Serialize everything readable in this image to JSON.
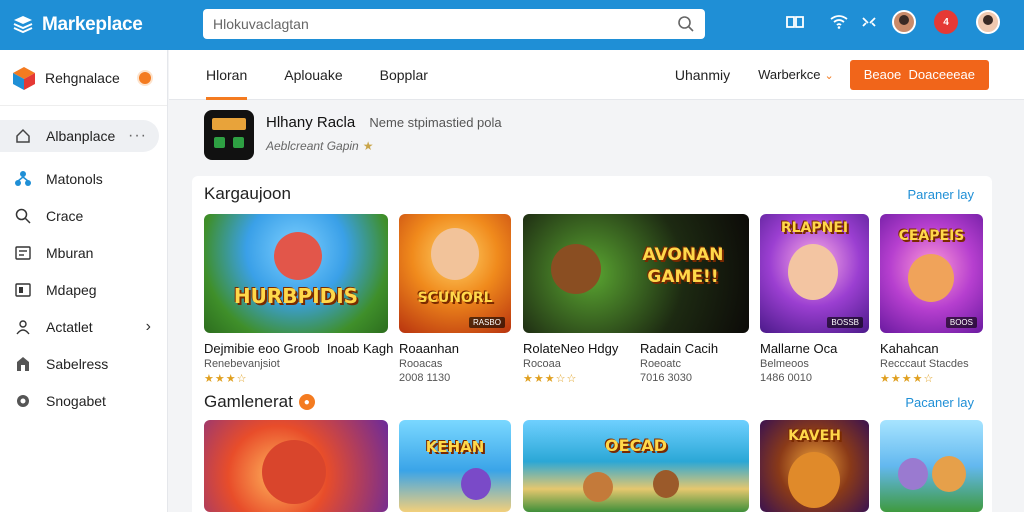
{
  "app": {
    "title": "Markeplace",
    "search_placeholder": "Hlokuvaclagtan"
  },
  "topbar_icons": [
    "book-icon",
    "wifi-icon",
    "tools-icon",
    "user-avatar",
    "notification-badge",
    "user-avatar-2"
  ],
  "notification_count": "4",
  "sidebar": {
    "brand_label": "Rehgnalace",
    "active_item": {
      "label": "Albanplace",
      "icon": "home-icon"
    },
    "items": [
      {
        "label": "Matonols",
        "icon": "network-icon"
      },
      {
        "label": "Crace",
        "icon": "search-icon"
      },
      {
        "label": "Mburan",
        "icon": "list-icon"
      },
      {
        "label": "Mdapeg",
        "icon": "frame-icon"
      },
      {
        "label": "Actatlet",
        "icon": "person-icon",
        "has_chevron": true
      },
      {
        "label": "Sabelress",
        "icon": "store-icon"
      },
      {
        "label": "Snogabet",
        "icon": "puzzle-icon"
      }
    ]
  },
  "subnav": {
    "tabs": [
      {
        "label": "Hloran",
        "active": true
      },
      {
        "label": "Aplouake",
        "active": false
      },
      {
        "label": "Bopplar",
        "active": false
      }
    ],
    "link": "Uhanmiy",
    "select_label": "Warberkce",
    "cta_label": "Beaoe  Doaceeeae"
  },
  "featured": {
    "title": "Hlhany Racla",
    "subtitle": "Neme stpimastied pola",
    "meta": "Aeblcreant Gapin"
  },
  "sections": [
    {
      "title": "Kargaujoon",
      "link": "Paraner lay",
      "cards": [
        {
          "art_text": "HURBPIDIS",
          "title": "Dejmibie eoo Groob  Inoab Kagh",
          "subtitle": "Renebevanjsiot",
          "rating": "★★★☆",
          "tag": ""
        },
        {
          "art_text": "SCUNORL",
          "title": "Roaanhan",
          "subtitle": "Rooacas",
          "rating": "2008 1130",
          "tag": "RASBO"
        },
        {
          "art_text": "AVONAN GAME!!",
          "title": "RolateNeo Hdgy",
          "subtitle": "Rocoaa",
          "rating": "★★★☆☆",
          "tag": ""
        },
        {
          "art_text": "",
          "title": "Radain Cacih",
          "subtitle": "Roeoatc",
          "rating": "7016 3030",
          "tag": ""
        },
        {
          "art_text": "RLAPNEI",
          "title": "Mallarne Oca",
          "subtitle": "Belmeoos",
          "rating": "1486 0010",
          "tag": "BOSSB"
        },
        {
          "art_text": "CEAPEIS",
          "title": "Kahahcan",
          "subtitle": "Recccaut Stacdes",
          "rating": "★★★★☆",
          "tag": "BOOS"
        }
      ]
    },
    {
      "title": "Gamlenerat",
      "link": "Pacaner lay",
      "cards": [
        {
          "art_text": "",
          "title": "",
          "subtitle": "",
          "rating": "",
          "tag": ""
        },
        {
          "art_text": "KEHAN",
          "title": "",
          "subtitle": "",
          "rating": "",
          "tag": ""
        },
        {
          "art_text": "OECAD",
          "title": "",
          "subtitle": "",
          "rating": "",
          "tag": ""
        },
        {
          "art_text": "KAVEH",
          "title": "",
          "subtitle": "",
          "rating": "",
          "tag": ""
        },
        {
          "art_text": "",
          "title": "",
          "subtitle": "",
          "rating": "",
          "tag": ""
        }
      ]
    }
  ],
  "colors": {
    "topbar": "#1f8fd6",
    "accent": "#f47b20",
    "cta": "#f1651a",
    "link": "#1f8fd6"
  }
}
